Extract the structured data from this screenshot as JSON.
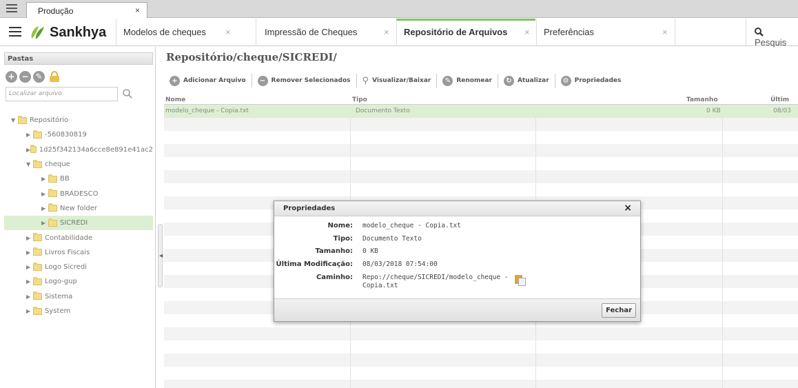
{
  "browser": {
    "tab_title": "Produção",
    "tab_close": "×"
  },
  "app": {
    "logo": "Sankhya",
    "tabs": [
      {
        "label": "Modelos de cheques",
        "close": "×"
      },
      {
        "label": "Impressão de Cheques",
        "close": "×"
      },
      {
        "label": "Repositório de Arquivos",
        "close": "×",
        "active": true
      },
      {
        "label": "Preferências",
        "close": "×"
      }
    ],
    "search_label": "Pesquis",
    "accent_color": "#7dc35b"
  },
  "left_panel": {
    "header": "Pastas",
    "search_placeholder": "Localizar arquivo",
    "tree": [
      {
        "label": "Repositório",
        "level": 0,
        "expanded": true
      },
      {
        "label": "-560830819",
        "level": 1
      },
      {
        "label": "1d25f342134a6cce8e891e41ac2",
        "level": 1
      },
      {
        "label": "cheque",
        "level": 1,
        "expanded": true
      },
      {
        "label": "BB",
        "level": 2
      },
      {
        "label": "BRADESCO",
        "level": 2
      },
      {
        "label": "New folder",
        "level": 2
      },
      {
        "label": "SICREDI",
        "level": 2,
        "selected": true
      },
      {
        "label": "Contabilidade",
        "level": 1
      },
      {
        "label": "Livros Fiscais",
        "level": 1
      },
      {
        "label": "Logo Sicredi",
        "level": 1
      },
      {
        "label": "Logo-gup",
        "level": 1
      },
      {
        "label": "Sistema",
        "level": 1
      },
      {
        "label": "System",
        "level": 1
      }
    ]
  },
  "main": {
    "path_title": "Repositório/cheque/SICREDI/",
    "toolbar": {
      "add": "Adicionar Arquivo",
      "remove": "Remover Selecionados",
      "view": "Visualizar/Baixar",
      "rename": "Renomear",
      "refresh": "Atualizar",
      "properties": "Propriedades"
    },
    "columns": {
      "name": "Nome",
      "type": "Tipo",
      "size": "Tamanho",
      "modified": "Últim"
    },
    "rows": [
      {
        "name": "modelo_cheque - Copia.txt",
        "type": "Documento Texto",
        "size": "0 KB",
        "modified": "08/03"
      }
    ]
  },
  "dialog": {
    "title": "Propriedades",
    "close": "×",
    "labels": {
      "name": "Nome:",
      "type": "Tipo:",
      "size": "Tamanho:",
      "modified": "Última Modificação:",
      "path": "Caminho:"
    },
    "values": {
      "name": "modelo_cheque - Copia.txt",
      "type": "Documento Texto",
      "size": "0 KB",
      "modified": "08/03/2018 07:54:00",
      "path": "Repo://cheque/SICREDI/modelo_cheque - Copia.txt"
    },
    "close_button": "Fechar"
  }
}
